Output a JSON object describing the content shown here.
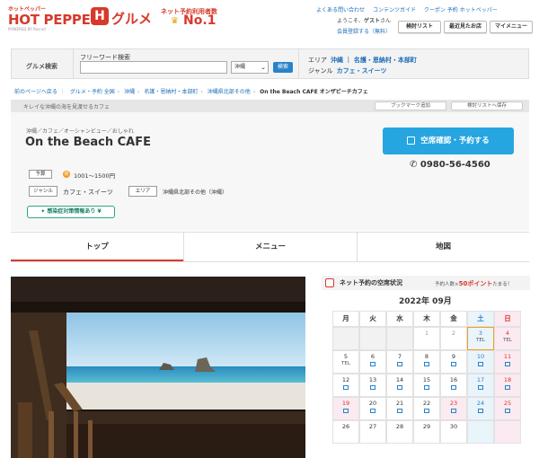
{
  "header": {
    "logo_small": "ホットペッパー",
    "logo_main": "HOT PEPPER",
    "logo_h": "H",
    "logo_gourmet": "グルメ",
    "logo_sub": "POWERED BY Recruit",
    "rank_text": "ネット予約利用者数",
    "rank_no1": "No.1",
    "top_links": [
      "よくある問い合わせ",
      "コンテンツガイド",
      "クーポン 予約 ホットペッパー"
    ],
    "welcome_prefix": "ようこそ、",
    "welcome_name": "ゲスト",
    "welcome_suffix": "さん",
    "register": "会員登録する（無料）",
    "buttons": [
      "検討リスト",
      "最近見たお店",
      "マイメニュー"
    ]
  },
  "search": {
    "label": "グルメ検索",
    "freeword_label": "フリーワード検索",
    "freeword_value": "",
    "pref_value": "沖縄",
    "button": "検索",
    "area_label": "エリア",
    "area_value": "沖縄 ｜ 名護・恩納村・本部町",
    "genre_label": "ジャンル",
    "genre_value": "カフェ・スイーツ"
  },
  "breadcrumb": {
    "items": [
      "前のページへ戻る",
      "グルメ・予約 全国",
      "沖縄",
      "名護・恩納村・本部町",
      "沖縄県北部その他"
    ],
    "current": "On the Beach CAFE オンザビーチカフェ"
  },
  "catch_bar": {
    "text": "キレイな沖縄の海を見渡せるカフェ",
    "bookmark": "ブックマーク追加",
    "save": "検討リストへ保存"
  },
  "store": {
    "category": "沖縄／カフェ／オーシャンビュー／おしゃれ",
    "name": "On the Beach CAFE",
    "budget_label": "予算",
    "budget_icon": "夜",
    "budget_value": "1001～1500円",
    "genre_label": "ジャンル",
    "genre_value": "カフェ・スイーツ",
    "area_label": "エリア",
    "area_value": "沖縄県北部その他（沖縄）",
    "covid_button": "感染症対策情報あり ¥",
    "reserve_button": "空席確認・予約する",
    "phone": "0980-56-4560"
  },
  "tabs": [
    "トップ",
    "メニュー",
    "地図"
  ],
  "calendar": {
    "title": "ネット予約の空席状況",
    "note_prefix": "予約人数×",
    "note_points": "50ポイント",
    "note_suffix": "たまる！",
    "month": "2022年 09月",
    "dow": [
      "月",
      "火",
      "水",
      "木",
      "金",
      "土",
      "日"
    ],
    "rows": [
      [
        {
          "d": "",
          "m": "",
          "t": "empty"
        },
        {
          "d": "",
          "m": "",
          "t": "empty"
        },
        {
          "d": "",
          "m": "",
          "t": "empty"
        },
        {
          "d": "1",
          "m": "",
          "t": "past"
        },
        {
          "d": "2",
          "m": "",
          "t": "past"
        },
        {
          "d": "3",
          "m": "TEL",
          "t": "today-sat"
        },
        {
          "d": "4",
          "m": "TEL",
          "t": "sun"
        }
      ],
      [
        {
          "d": "5",
          "m": "TEL",
          "t": "n"
        },
        {
          "d": "6",
          "m": "sq",
          "t": "n"
        },
        {
          "d": "7",
          "m": "sq",
          "t": "n"
        },
        {
          "d": "8",
          "m": "sq",
          "t": "n"
        },
        {
          "d": "9",
          "m": "sq",
          "t": "n"
        },
        {
          "d": "10",
          "m": "sq",
          "t": "sat"
        },
        {
          "d": "11",
          "m": "sq",
          "t": "sun"
        }
      ],
      [
        {
          "d": "12",
          "m": "sq",
          "t": "n"
        },
        {
          "d": "13",
          "m": "sq",
          "t": "n"
        },
        {
          "d": "14",
          "m": "sq",
          "t": "n"
        },
        {
          "d": "15",
          "m": "sq",
          "t": "n"
        },
        {
          "d": "16",
          "m": "sq",
          "t": "n"
        },
        {
          "d": "17",
          "m": "sq",
          "t": "sat"
        },
        {
          "d": "18",
          "m": "sq",
          "t": "sun"
        }
      ],
      [
        {
          "d": "19",
          "m": "sq",
          "t": "sun"
        },
        {
          "d": "20",
          "m": "sq",
          "t": "n"
        },
        {
          "d": "21",
          "m": "sq",
          "t": "n"
        },
        {
          "d": "22",
          "m": "sq",
          "t": "n"
        },
        {
          "d": "23",
          "m": "sq",
          "t": "sun"
        },
        {
          "d": "24",
          "m": "sq",
          "t": "sat"
        },
        {
          "d": "25",
          "m": "sq",
          "t": "sun"
        }
      ],
      [
        {
          "d": "26",
          "m": "",
          "t": "n"
        },
        {
          "d": "27",
          "m": "",
          "t": "n"
        },
        {
          "d": "28",
          "m": "",
          "t": "n"
        },
        {
          "d": "29",
          "m": "",
          "t": "n"
        },
        {
          "d": "30",
          "m": "",
          "t": "n"
        },
        {
          "d": "",
          "m": "",
          "t": "empty-sat"
        },
        {
          "d": "",
          "m": "",
          "t": "empty-sun"
        }
      ]
    ]
  },
  "colors": {
    "brand_red": "#d8392b",
    "reserve_blue": "#26a5e0",
    "link_blue": "#1f6fb8",
    "covid_green": "#27a887"
  }
}
